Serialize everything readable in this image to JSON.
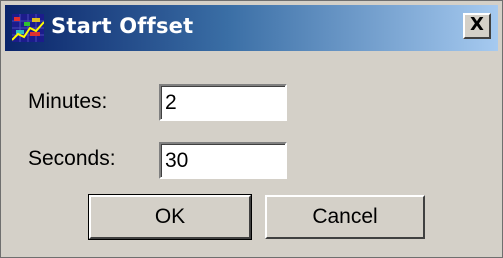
{
  "window": {
    "title": "Start Offset",
    "close_label": "X",
    "icon": "chart-app-icon"
  },
  "form": {
    "minutes_label": "Minutes:",
    "minutes_value": "2",
    "seconds_label": "Seconds:",
    "seconds_value": "30"
  },
  "buttons": {
    "ok_label": "OK",
    "cancel_label": "Cancel"
  }
}
